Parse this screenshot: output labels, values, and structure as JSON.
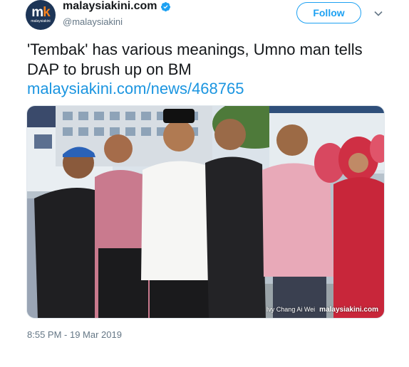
{
  "account": {
    "display_name": "malaysiakini.com",
    "handle": "@malaysiakini",
    "avatar_text": "mk",
    "avatar_subtext": "malaysiakini",
    "verified": true
  },
  "actions": {
    "follow_label": "Follow",
    "menu_icon": "chevron-down-icon"
  },
  "tweet": {
    "text": "'Tembak' has various meanings, Umno man tells DAP to brush up on BM",
    "link": "malaysiakini.com/news/468765",
    "timestamp": "8:55 PM - 19 Mar 2019"
  },
  "photo": {
    "credit": "Ivy Chang Ai Wei",
    "watermark": "malaysiakini.com"
  },
  "colors": {
    "accent": "#1da1f2",
    "link": "#1b95e0",
    "muted": "#657786",
    "avatar_bg": "#1d3557",
    "avatar_k": "#f5821f"
  }
}
